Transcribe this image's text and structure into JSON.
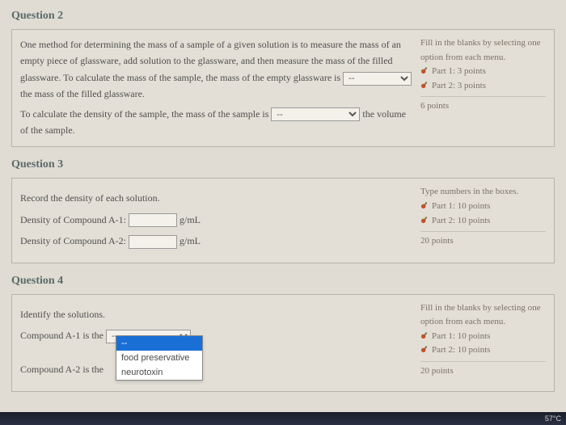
{
  "q2": {
    "title": "Question 2",
    "text_a": "One method for determining the mass of a sample of a given solution is to measure the mass of an empty piece of glassware, add solution to the glassware, and then measure the mass of the filled glassware. To calculate the mass of the sample, the mass of the empty glassware is ",
    "blank1": "--",
    "text_b": " the mass of the filled glassware.",
    "text_c": "To calculate the density of the sample, the mass of the sample is ",
    "blank2": "--",
    "text_d": " the volume of the sample.",
    "sidebar": {
      "instr": "Fill in the blanks by selecting one option from each menu.",
      "part1": "Part 1: 3 points",
      "part2": "Part 2: 3 points",
      "total": "6 points"
    }
  },
  "q3": {
    "title": "Question 3",
    "head": "Record the density of each solution.",
    "row1_label": "Density of Compound A-1:",
    "row2_label": "Density of Compound A-2:",
    "unit": "g/mL",
    "sidebar": {
      "instr": "Type numbers in the boxes.",
      "part1": "Part 1: 10 points",
      "part2": "Part 2: 10 points",
      "total": "20 points"
    }
  },
  "q4": {
    "title": "Question 4",
    "head": "Identify the solutions.",
    "row1_label": "Compound A-1 is the ",
    "row2_label": "Compound A-2 is the",
    "blank": "--",
    "options": [
      "--",
      "food preservative",
      "neurotoxin"
    ],
    "sidebar": {
      "instr": "Fill in the blanks by selecting one option from each menu.",
      "part1": "Part 1: 10 points",
      "part2": "Part 2: 10 points",
      "total": "20 points"
    }
  },
  "taskbar": {
    "temp": "57°C"
  }
}
